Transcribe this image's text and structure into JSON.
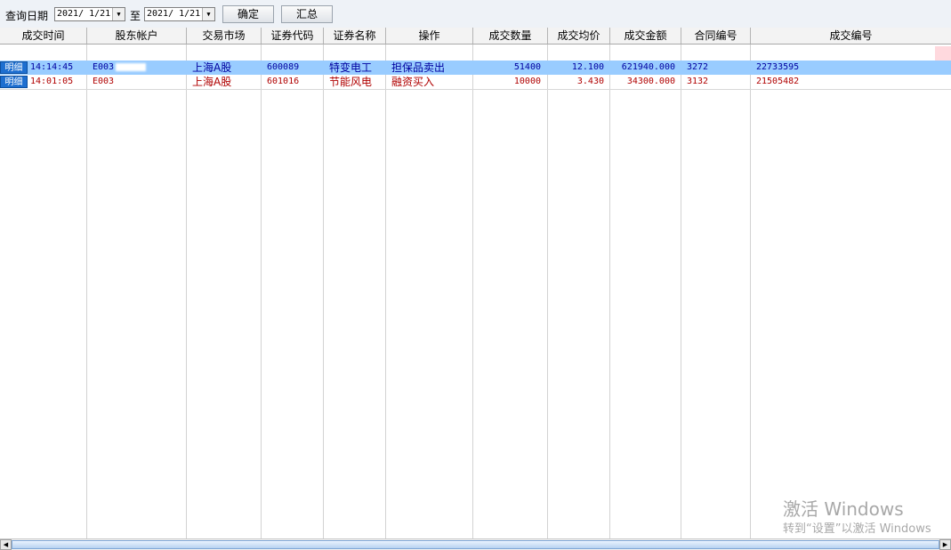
{
  "toolbar": {
    "query_label": "查询日期",
    "date_from": "2021/ 1/21",
    "to_label": "至",
    "date_to": "2021/ 1/21",
    "confirm_label": "确定",
    "summary_label": "汇总"
  },
  "columns": [
    "成交时间",
    "股东帐户",
    "交易市场",
    "证券代码",
    "证券名称",
    "操作",
    "成交数量",
    "成交均价",
    "成交金额",
    "合同编号",
    "成交编号"
  ],
  "rows": [
    {
      "badge": "明细",
      "time": "14:14:45",
      "account": "E003",
      "market": "上海A股",
      "code": "600089",
      "name": "特变电工",
      "op": "担保品卖出",
      "qty": "51400",
      "avg_price": "12.100",
      "amount": "621940.000",
      "contract": "3272",
      "deal_no": "22733595",
      "selected": true
    },
    {
      "badge": "明细",
      "time": "14:01:05",
      "account": "E003",
      "market": "上海A股",
      "code": "601016",
      "name": "节能风电",
      "op": "融资买入",
      "qty": "10000",
      "avg_price": "3.430",
      "amount": "34300.000",
      "contract": "3132",
      "deal_no": "21505482",
      "selected": false
    }
  ],
  "colors": {
    "row_sell_text": "#0000a0",
    "row_buy_text": "#b00000",
    "selected_bg": "#99ccff",
    "badge_bg": "#1e6fd0"
  },
  "watermark": {
    "line1": "激活 Windows",
    "line2": "转到“设置”以激活 Windows"
  },
  "icons": [
    "dropdown-arrow-icon",
    "scroll-left-icon",
    "scroll-right-icon"
  ]
}
